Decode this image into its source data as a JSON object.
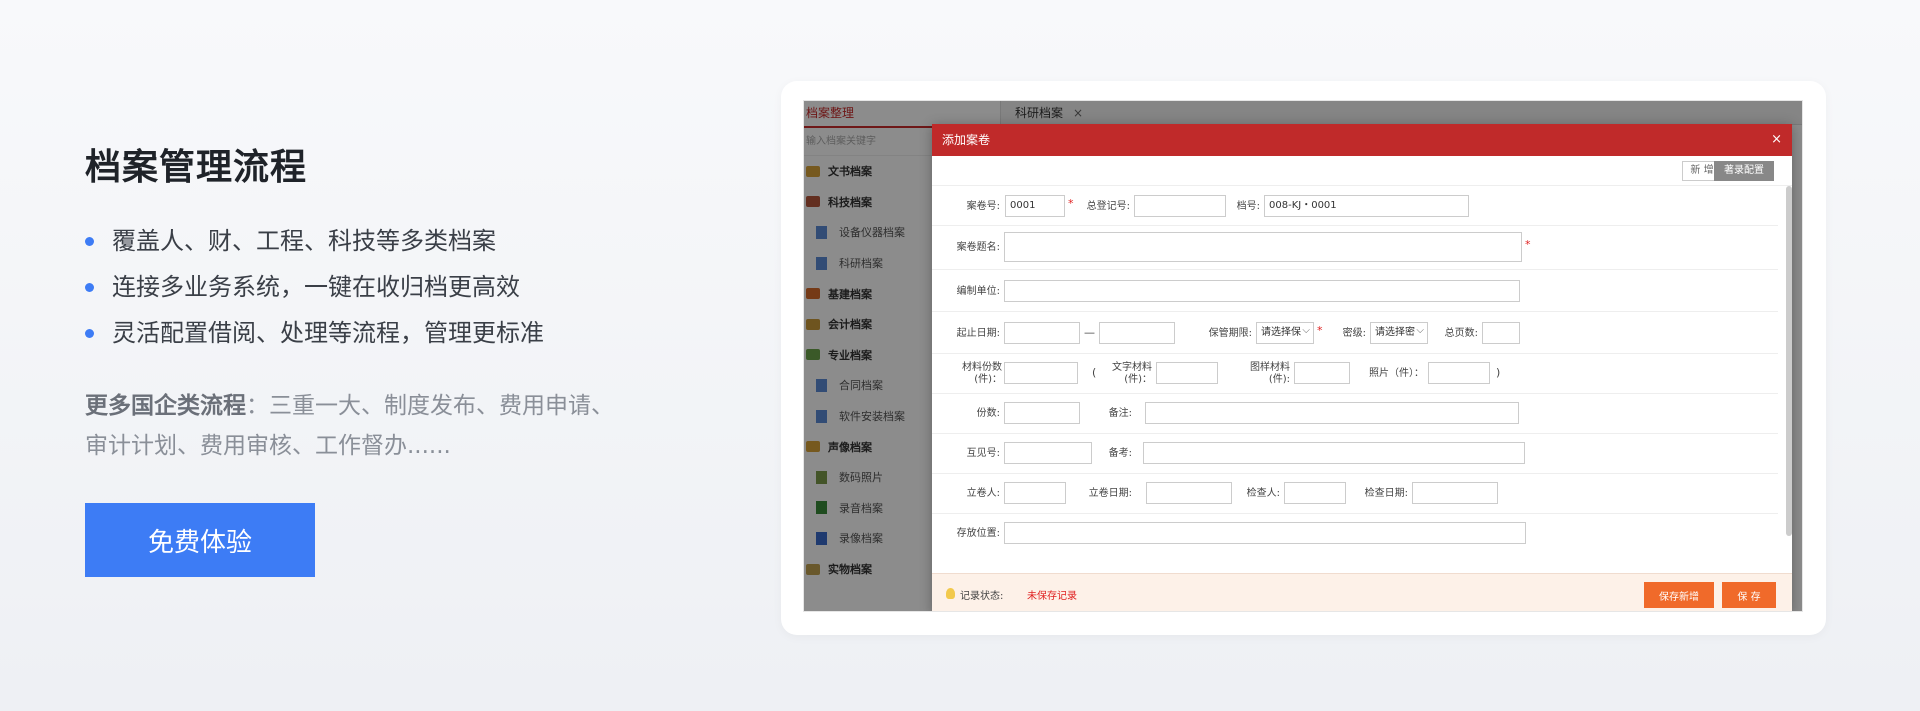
{
  "hero": {
    "title": "档案管理流程",
    "bullets": [
      "覆盖人、财、工程、科技等多类档案",
      "连接多业务系统，一键在收归档更高效",
      "灵活配置借阅、处理等流程，管理更标准"
    ],
    "more_label": "更多国企类流程",
    "more_text": "：三重一大、制度发布、费用申请、审计计划、费用审核、工作督办......",
    "cta": "免费体验"
  },
  "app": {
    "sidebar_title": "档案整理",
    "search_placeholder": "输入档案关键字",
    "nav": [
      {
        "label": "文书档案",
        "type": "group",
        "icon": "folder-icon",
        "color": "#d7a23a"
      },
      {
        "label": "科技档案",
        "type": "group",
        "icon": "folder-icon",
        "color": "#b5563b"
      },
      {
        "label": "设备仪器档案",
        "type": "sub",
        "icon": "document-icon",
        "color": "#5b8bd6"
      },
      {
        "label": "科研档案",
        "type": "sub",
        "icon": "document-icon",
        "color": "#5b8bd6"
      },
      {
        "label": "基建档案",
        "type": "group",
        "icon": "folder-icon",
        "color": "#d66b2a"
      },
      {
        "label": "会计档案",
        "type": "group",
        "icon": "folder-icon",
        "color": "#c99a3a"
      },
      {
        "label": "专业档案",
        "type": "group",
        "icon": "folder-icon",
        "color": "#6aa34a"
      },
      {
        "label": "合同档案",
        "type": "sub",
        "icon": "document-icon",
        "color": "#5b8bd6"
      },
      {
        "label": "软件安装档案",
        "type": "sub",
        "icon": "document-icon",
        "color": "#5b8bd6"
      },
      {
        "label": "声像档案",
        "type": "group",
        "icon": "folder-icon",
        "color": "#d7a23a"
      },
      {
        "label": "数码照片",
        "type": "sub",
        "icon": "photo-icon",
        "color": "#7a9a4a"
      },
      {
        "label": "录音档案",
        "type": "sub",
        "icon": "music-icon",
        "color": "#3a8a3a"
      },
      {
        "label": "录像档案",
        "type": "sub",
        "icon": "video-icon",
        "color": "#3a6aca"
      },
      {
        "label": "实物档案",
        "type": "group",
        "icon": "folder-icon",
        "color": "#c0a050"
      }
    ],
    "tab_label": "科研档案",
    "tab_close": "×"
  },
  "modal": {
    "title": "添加案卷",
    "close": "×",
    "btn_new": "新 增",
    "btn_config": "著录配置",
    "labels": {
      "volume_no": "案卷号:",
      "total_reg_no": "总登记号:",
      "file_no": "档号:",
      "volume_title": "案卷题名:",
      "compiler": "编制单位:",
      "date_range": "起止日期:",
      "date_sep": "—",
      "retention": "保管期限:",
      "secrecy": "密级:",
      "total_pages": "总页数:",
      "material_copies": "材料份数\n(件)：",
      "text_material": "文字材料\n(件)：",
      "drawing_material": "图样材料\n(件):",
      "photos": "照片（件）：",
      "copies": "份数:",
      "remarks": "备注:",
      "cross_ref": "互见号:",
      "notes": "备考:",
      "filer": "立卷人:",
      "file_date": "立卷日期:",
      "checker": "检查人:",
      "check_date": "检查日期:",
      "location": "存放位置:"
    },
    "values": {
      "volume_no": "0001",
      "file_no": "008-KJ・0001",
      "retention": "请选择保",
      "secrecy": "请选择密"
    },
    "status_label": "记录状态:",
    "status_value": "未保存记录",
    "btn_save_new": "保存新增",
    "btn_save": "保 存"
  }
}
